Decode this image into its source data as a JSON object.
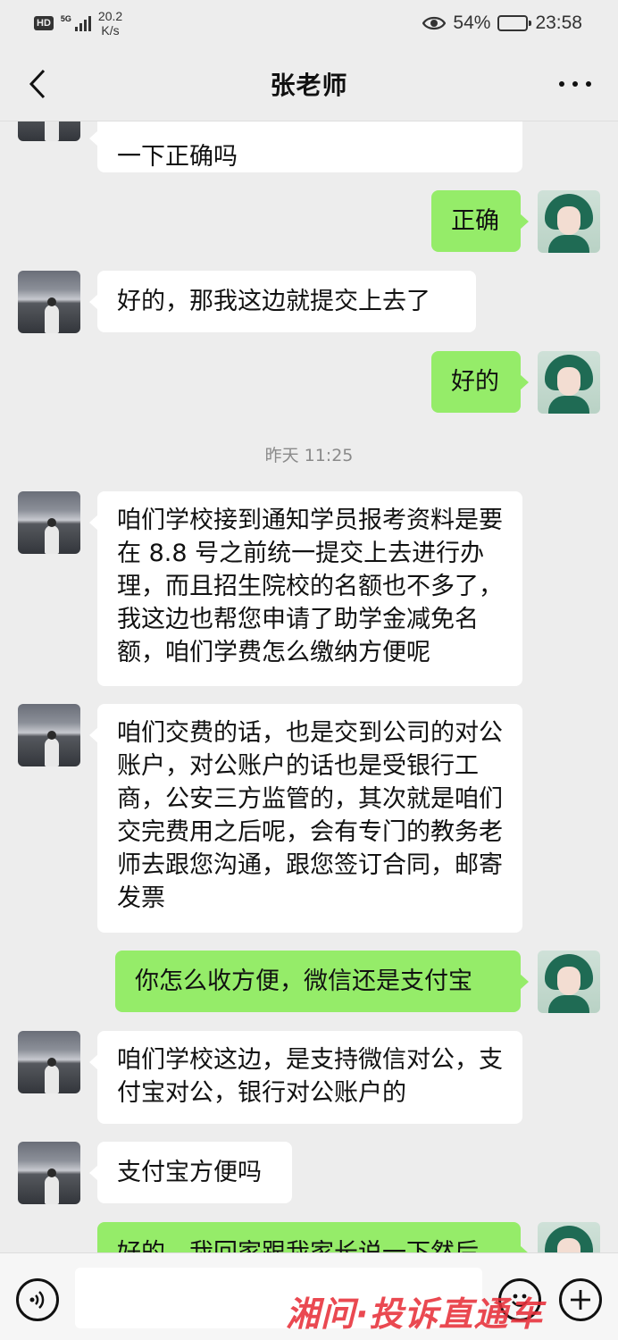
{
  "status_bar": {
    "hd": "HD",
    "network": "5G",
    "speed_value": "20.2",
    "speed_unit": "K/s",
    "battery": "54%",
    "battery_level": 0.54,
    "time": "23:58"
  },
  "header": {
    "title": "张老师"
  },
  "messages": [
    {
      "from": "teacher",
      "text": "一下正确吗"
    },
    {
      "from": "me",
      "text": "正确"
    },
    {
      "from": "teacher",
      "text": "好的，那我这边就提交上去了"
    },
    {
      "from": "me",
      "text": "好的"
    },
    {
      "type": "time",
      "text": "昨天 11:25"
    },
    {
      "from": "teacher",
      "text": "咱们学校接到通知学员报考资料是要在 8.8 号之前统一提交上去进行办理，而且招生院校的名额也不多了，我这边也帮您申请了助学金减免名额，咱们学费怎么缴纳方便呢"
    },
    {
      "from": "teacher",
      "text": "咱们交费的话，也是交到公司的对公账户，对公账户的话也是受银行工商，公安三方监管的，其次就是咱们交完费用之后呢，会有专门的教务老师去跟您沟通，跟您签订合同，邮寄发票"
    },
    {
      "from": "me",
      "text": "你怎么收方便，微信还是支付宝"
    },
    {
      "from": "teacher",
      "text": "咱们学校这边，是支持微信对公，支付宝对公，银行对公账户的"
    },
    {
      "from": "teacher",
      "text": "支付宝方便吗"
    },
    {
      "from": "me",
      "text": "好的，我回家跟我家长说一下然后"
    }
  ],
  "input_bar": {
    "placeholder": ""
  },
  "watermark": "湘问·投诉直通车",
  "colors": {
    "background": "#ededed",
    "my_bubble": "#95ec69",
    "their_bubble": "#ffffff",
    "watermark": "#e8303a"
  },
  "icons": [
    "back-icon",
    "more-icon",
    "voice-icon",
    "emoji-icon",
    "plus-icon",
    "eye-icon",
    "battery-icon",
    "signal-icon"
  ]
}
